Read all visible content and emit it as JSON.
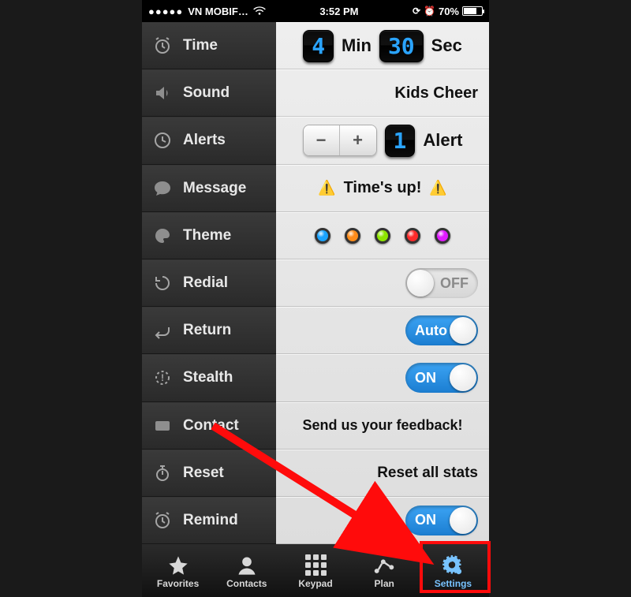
{
  "statusbar": {
    "carrier": "VN MOBIF…",
    "time": "3:52 PM",
    "battery_pct": "70%"
  },
  "sidebar": {
    "items": [
      {
        "key": "time",
        "label": "Time"
      },
      {
        "key": "sound",
        "label": "Sound"
      },
      {
        "key": "alerts",
        "label": "Alerts"
      },
      {
        "key": "message",
        "label": "Message"
      },
      {
        "key": "theme",
        "label": "Theme"
      },
      {
        "key": "redial",
        "label": "Redial"
      },
      {
        "key": "return",
        "label": "Return"
      },
      {
        "key": "stealth",
        "label": "Stealth"
      },
      {
        "key": "contact",
        "label": "Contact"
      },
      {
        "key": "reset",
        "label": "Reset"
      },
      {
        "key": "remind",
        "label": "Remind"
      }
    ]
  },
  "settings": {
    "time": {
      "minutes": "4",
      "seconds": "30",
      "min_label": "Min",
      "sec_label": "Sec"
    },
    "sound": {
      "name": "Kids Cheer"
    },
    "alerts": {
      "count": "1",
      "label": "Alert"
    },
    "message": {
      "text": "Time's up!"
    },
    "theme": {
      "colors": [
        "#1aa3ff",
        "#ff8c1a",
        "#8ee600",
        "#ff2a2a",
        "#e01aff"
      ]
    },
    "redial": {
      "state": "off",
      "label": "OFF"
    },
    "return": {
      "state": "on",
      "label": "Auto"
    },
    "stealth": {
      "state": "on",
      "label": "ON"
    },
    "contact": {
      "text": "Send us your feedback!"
    },
    "reset": {
      "text": "Reset all stats"
    },
    "remind": {
      "state": "on",
      "label": "ON"
    }
  },
  "tabs": {
    "items": [
      {
        "key": "favorites",
        "label": "Favorites"
      },
      {
        "key": "contacts",
        "label": "Contacts"
      },
      {
        "key": "keypad",
        "label": "Keypad"
      },
      {
        "key": "plan",
        "label": "Plan"
      },
      {
        "key": "settings",
        "label": "Settings"
      }
    ],
    "active": "settings"
  }
}
